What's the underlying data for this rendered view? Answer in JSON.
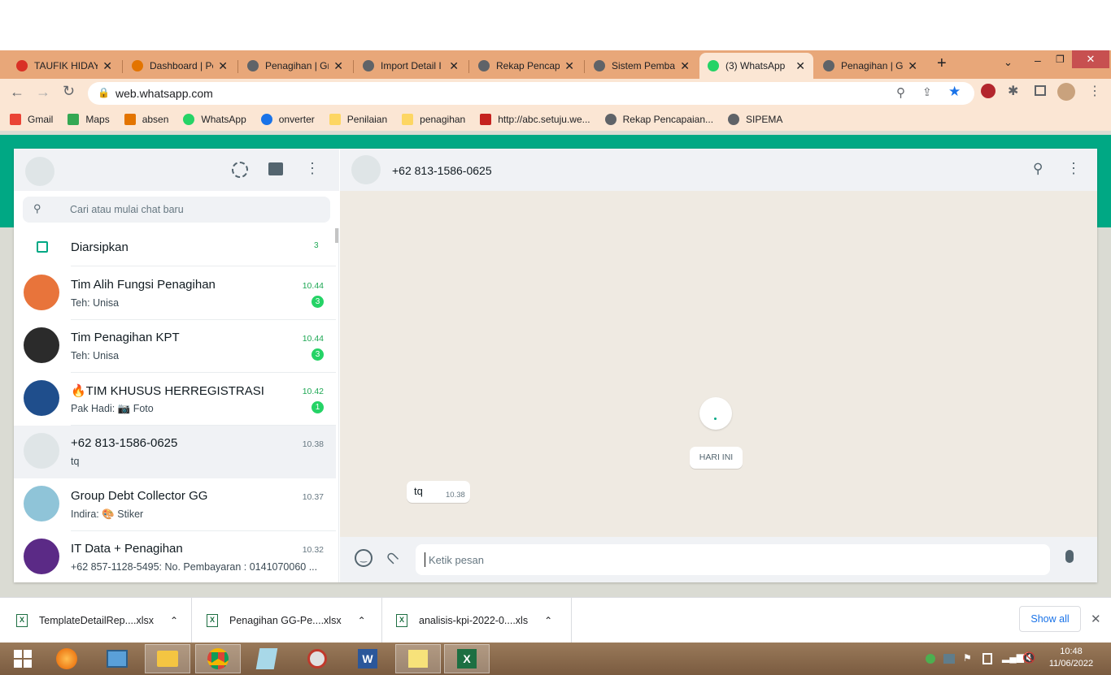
{
  "browser": {
    "tabs": [
      {
        "title": "TAUFIK HIDAY",
        "color": "#d93025"
      },
      {
        "title": "Dashboard | Pe",
        "color": "#e37400"
      },
      {
        "title": "Penagihan | Gr",
        "color": "#5f6368"
      },
      {
        "title": "Import Detail I",
        "color": "#5f6368"
      },
      {
        "title": "Rekap Pencapa",
        "color": "#5f6368"
      },
      {
        "title": "Sistem Pemba",
        "color": "#5f6368"
      },
      {
        "title": "(3) WhatsApp",
        "color": "#25d366"
      },
      {
        "title": "Penagihan | Gr",
        "color": "#5f6368"
      }
    ],
    "url": "web.whatsapp.com",
    "bookmarks": [
      {
        "label": "Gmail",
        "color": "#ea4335"
      },
      {
        "label": "Maps",
        "color": "#34a853"
      },
      {
        "label": "absen",
        "color": "#e37400"
      },
      {
        "label": "WhatsApp",
        "color": "#25d366"
      },
      {
        "label": "onverter",
        "color": "#1a73e8"
      },
      {
        "label": "Penilaian",
        "color": "#fdd663"
      },
      {
        "label": "penagihan",
        "color": "#fdd663"
      },
      {
        "label": "http://abc.setuju.we...",
        "color": "#c5221f"
      },
      {
        "label": "Rekap Pencapaian...",
        "color": "#5f6368"
      },
      {
        "label": "SIPEMA",
        "color": "#5f6368"
      }
    ]
  },
  "sidebar": {
    "search_placeholder": "Cari atau mulai chat baru",
    "archived_label": "Diarsipkan",
    "archived_count": "3",
    "chats": [
      {
        "name": "Tim Alih Fungsi Penagihan",
        "last": "Teh: Unisa",
        "time": "10.44",
        "unread": "3",
        "avatar": "#e8743b"
      },
      {
        "name": "Tim Penagihan KPT",
        "last": "Teh: Unisa",
        "time": "10.44",
        "unread": "3",
        "avatar": "#2b2b2b"
      },
      {
        "name": "🔥TIM KHUSUS HERREGISTRASI",
        "last": "Pak Hadi: 📷 Foto",
        "time": "10.42",
        "unread": "1",
        "avatar": "#1f4e8c"
      },
      {
        "name": "+62 813-1586-0625",
        "last": "tq",
        "time": "10.38",
        "unread": "",
        "avatar": "#dfe5e7"
      },
      {
        "name": "Group Debt Collector GG",
        "last": "Indira: 🎨 Stiker",
        "time": "10.37",
        "unread": "",
        "avatar": "#8fc4d8"
      },
      {
        "name": "IT Data + Penagihan",
        "last": "+62 857-1128-5495: No. Pembayaran :  0141070060 ...",
        "time": "10.32",
        "unread": "",
        "avatar": "#5b2a86"
      }
    ]
  },
  "conversation": {
    "contact": "+62 813-1586-0625",
    "date_chip": "HARI INI",
    "messages": [
      {
        "text": "tq",
        "time": "10.38"
      }
    ],
    "input_placeholder": "Ketik pesan"
  },
  "downloads": {
    "items": [
      {
        "name": "TemplateDetailRep....xlsx"
      },
      {
        "name": "Penagihan  GG-Pe....xlsx"
      },
      {
        "name": "analisis-kpi-2022-0....xls"
      }
    ],
    "show_all": "Show all"
  },
  "taskbar": {
    "time": "10:48",
    "date": "11/06/2022"
  }
}
